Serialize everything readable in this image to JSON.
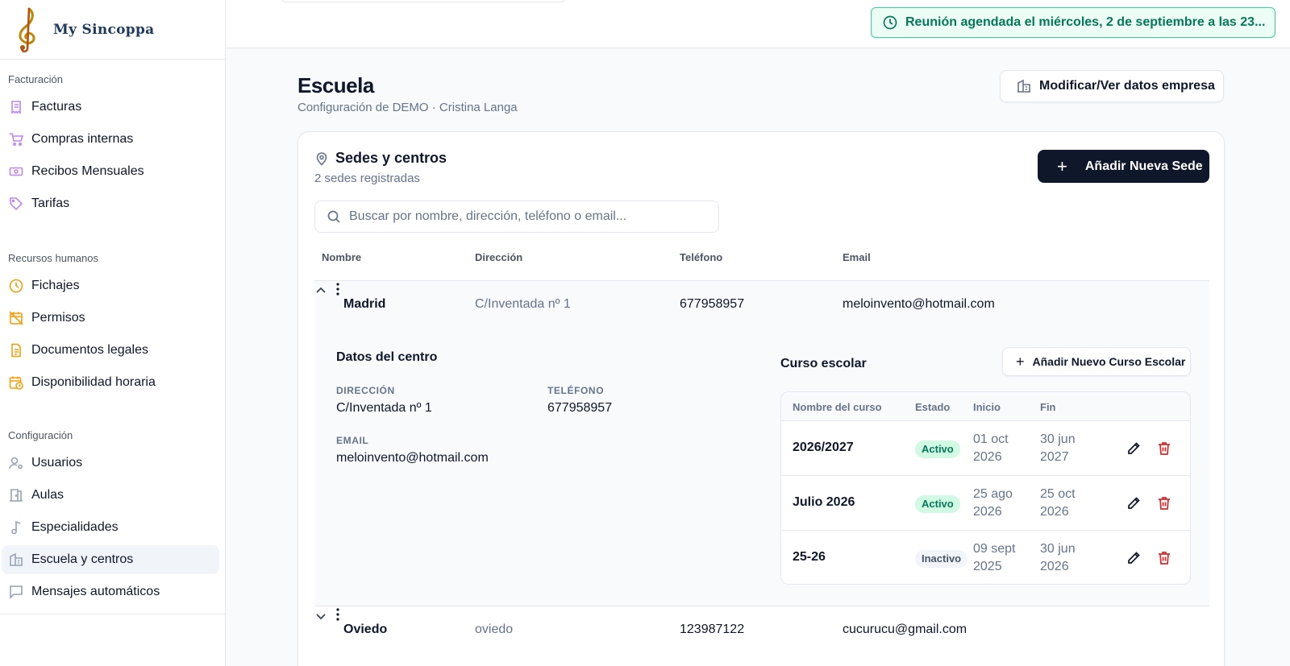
{
  "brand": {
    "name": "My Sincoppa",
    "logo_icon": "treble-clef-logo"
  },
  "sidebar": {
    "sections": [
      {
        "title": "Facturación",
        "items": [
          {
            "label": "Facturas",
            "icon": "receipt-icon"
          },
          {
            "label": "Compras internas",
            "icon": "cart-icon"
          },
          {
            "label": "Recibos Mensuales",
            "icon": "banknote-icon"
          },
          {
            "label": "Tarifas",
            "icon": "tag-icon"
          }
        ]
      },
      {
        "title": "Recursos humanos",
        "items": [
          {
            "label": "Fichajes",
            "icon": "clock-icon"
          },
          {
            "label": "Permisos",
            "icon": "calendar-off-icon"
          },
          {
            "label": "Documentos legales",
            "icon": "document-icon"
          },
          {
            "label": "Disponibilidad horaria",
            "icon": "calendar-clock-icon"
          }
        ]
      },
      {
        "title": "Configuración",
        "items": [
          {
            "label": "Usuarios",
            "icon": "user-cog-icon"
          },
          {
            "label": "Aulas",
            "icon": "door-icon"
          },
          {
            "label": "Especialidades",
            "icon": "music-note-icon"
          },
          {
            "label": "Escuela y centros",
            "icon": "building-icon",
            "active": true
          },
          {
            "label": "Mensajes automáticos",
            "icon": "message-icon"
          }
        ]
      }
    ]
  },
  "toast": {
    "text": "Reunión agendada el miércoles, 2 de septiembre a las 23...",
    "icon": "clock-icon"
  },
  "page": {
    "title": "Escuela",
    "subtitle": "Configuración de DEMO · Cristina Langa",
    "company_button": "Modificar/Ver datos empresa"
  },
  "card": {
    "title": "Sedes y centros",
    "subtitle": "2 sedes registradas",
    "add_button": "Añadir Nueva Sede",
    "search_placeholder": "Buscar por nombre, dirección, teléfono o email...",
    "columns": [
      "Nombre",
      "Dirección",
      "Teléfono",
      "Email"
    ],
    "rows": [
      {
        "name": "Madrid",
        "address": "C/Inventada nº 1",
        "phone": "677958957",
        "email": "meloinvento@hotmail.com",
        "expanded": true
      },
      {
        "name": "Oviedo",
        "address": "oviedo",
        "phone": "123987122",
        "email": "cucurucu@gmail.com",
        "expanded": false
      }
    ]
  },
  "detail": {
    "title": "Datos del centro",
    "address_label": "DIRECCIÓN",
    "address": "C/Inventada nº 1",
    "phone_label": "TELÉFONO",
    "phone": "677958957",
    "email_label": "EMAIL",
    "email": "meloinvento@hotmail.com",
    "course_title": "Curso escolar",
    "add_course_button": "Añadir Nuevo Curso Escolar",
    "course_columns": [
      "Nombre del curso",
      "Estado",
      "Inicio",
      "Fin"
    ],
    "courses": [
      {
        "name": "2026/2027",
        "status": "Activo",
        "status_kind": "active",
        "start": "01 oct 2026",
        "end": "30 jun 2027"
      },
      {
        "name": "Julio 2026",
        "status": "Activo",
        "status_kind": "active",
        "start": "25 ago 2026",
        "end": "25 oct 2026"
      },
      {
        "name": "25-26",
        "status": "Inactivo",
        "status_kind": "inactive",
        "start": "09 sept 2025",
        "end": "30 jun 2026"
      }
    ]
  },
  "colors": {
    "primary": "#0f172a",
    "success": "#047857",
    "success_bg": "#ecfdf5",
    "danger": "#dc2626",
    "purple_icon": "#c084fc",
    "amber_icon": "#f59e0b"
  }
}
